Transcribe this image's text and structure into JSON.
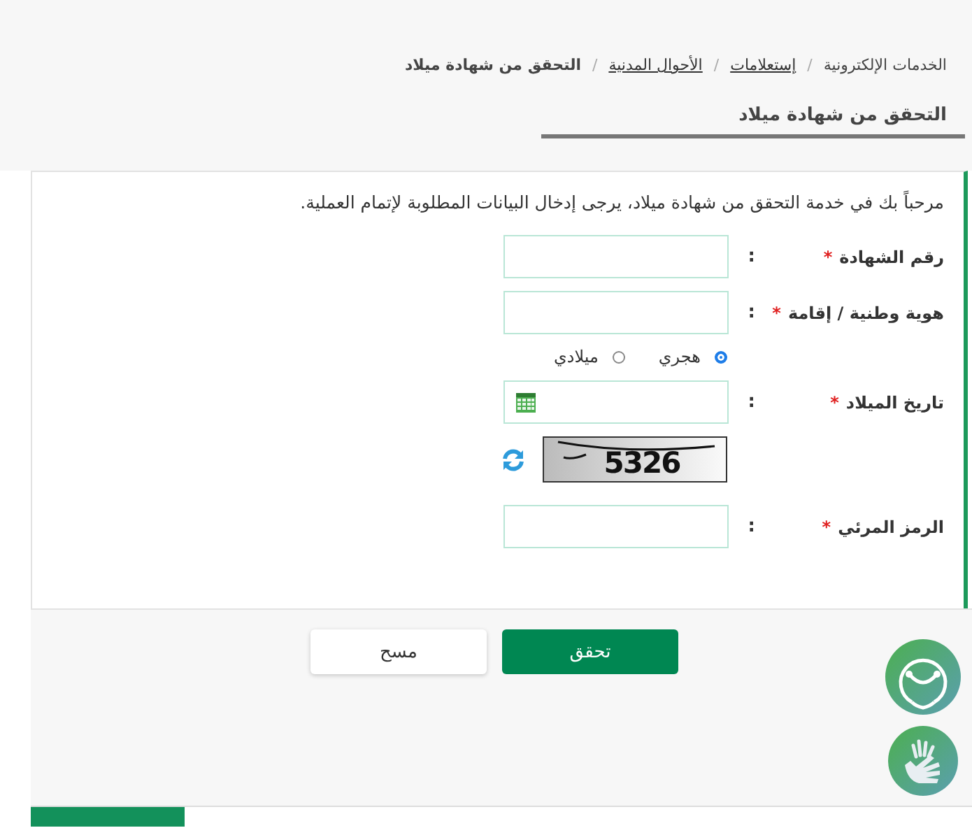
{
  "breadcrumb": [
    {
      "label": "الخدمات الإلكترونية",
      "kind": "plain"
    },
    {
      "separator": "/",
      "label": "إستعلامات",
      "kind": "link"
    },
    {
      "separator": "/",
      "label": "الأحوال المدنية",
      "kind": "link"
    },
    {
      "separator": "/",
      "label": "التحقق من شهادة ميلاد",
      "kind": "current"
    }
  ],
  "page_title": "التحقق من شهادة ميلاد",
  "intro": "مرحباً بك في خدمة التحقق من شهادة ميلاد، يرجى إدخال البيانات المطلوبة لإتمام العملية.",
  "fields": [
    {
      "kind": "text",
      "label": "رقم الشهادة",
      "marker": "*",
      "colon": ":"
    },
    {
      "kind": "text",
      "label": "هوية وطنية / إقامة",
      "marker": "*",
      "colon": ":"
    },
    {
      "kind": "radio",
      "options": [
        {
          "label": "هجري",
          "selected": true
        },
        {
          "label": "ميلادي",
          "selected": false
        }
      ]
    },
    {
      "kind": "date",
      "label": "تاريخ الميلاد",
      "marker": "*",
      "colon": ":"
    },
    {
      "kind": "captcha",
      "code": "5326"
    },
    {
      "kind": "text",
      "label": "الرمز المرئي",
      "marker": "*",
      "colon": ":"
    }
  ],
  "buttons": [
    {
      "label": "تحقق",
      "kind": "primary"
    },
    {
      "label": "مسح",
      "kind": "secondary"
    }
  ]
}
